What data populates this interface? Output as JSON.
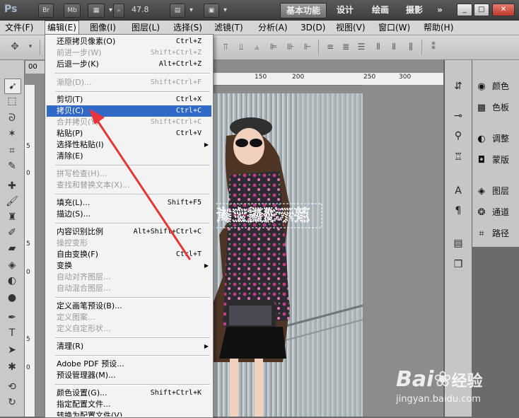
{
  "appbar": {
    "logo": "Ps",
    "btn_br": "Br",
    "btn_mb": "Mb",
    "zoom": "47.8",
    "workspaces": [
      "基本功能",
      "设计",
      "绘画",
      "摄影"
    ],
    "more": "»",
    "window_controls": [
      "_",
      "□",
      "✕"
    ]
  },
  "menubar": {
    "items": [
      "文件(F)",
      "编辑(E)",
      "图像(I)",
      "图层(L)",
      "选择(S)",
      "滤镜(T)",
      "分析(A)",
      "3D(D)",
      "视图(V)",
      "窗口(W)",
      "帮助(H)"
    ],
    "open_index": 1
  },
  "document": {
    "tab_label": "00",
    "ruler_ticks": [
      "150",
      "200",
      "250",
      "300"
    ],
    "ruler_left_ticks": [
      "5",
      "0",
      "5",
      "0",
      "5",
      "0"
    ],
    "selection_text": "淘宝摄影示范"
  },
  "edit_menu": {
    "items": [
      {
        "label": "还原拷贝像素(O)",
        "shortcut": "Ctrl+Z",
        "disabled": false
      },
      {
        "label": "前进一步(W)",
        "shortcut": "Shift+Ctrl+Z",
        "disabled": true
      },
      {
        "label": "后退一步(K)",
        "shortcut": "Alt+Ctrl+Z",
        "disabled": false
      },
      {
        "label": "渐隐(D)...",
        "shortcut": "Shift+Ctrl+F",
        "disabled": true
      },
      {
        "label": "剪切(T)",
        "shortcut": "Ctrl+X",
        "disabled": false
      },
      {
        "label": "拷贝(C)",
        "shortcut": "Ctrl+C",
        "disabled": false,
        "highlighted": true
      },
      {
        "label": "合并拷贝(Y)",
        "shortcut": "Shift+Ctrl+C",
        "disabled": true
      },
      {
        "label": "粘贴(P)",
        "shortcut": "Ctrl+V",
        "disabled": false
      },
      {
        "label": "选择性粘贴(I)",
        "shortcut": "",
        "disabled": false,
        "submenu": true
      },
      {
        "label": "清除(E)",
        "shortcut": "",
        "disabled": false
      },
      {
        "label": "拼写检查(H)...",
        "shortcut": "",
        "disabled": true
      },
      {
        "label": "查找和替换文本(X)...",
        "shortcut": "",
        "disabled": true
      },
      {
        "label": "填充(L)...",
        "shortcut": "Shift+F5",
        "disabled": false
      },
      {
        "label": "描边(S)...",
        "shortcut": "",
        "disabled": false
      },
      {
        "label": "内容识别比例",
        "shortcut": "Alt+Shift+Ctrl+C",
        "disabled": false
      },
      {
        "label": "操控变形",
        "shortcut": "",
        "disabled": true
      },
      {
        "label": "自由变换(F)",
        "shortcut": "Ctrl+T",
        "disabled": false
      },
      {
        "label": "变换",
        "shortcut": "",
        "disabled": false,
        "submenu": true
      },
      {
        "label": "自动对齐图层...",
        "shortcut": "",
        "disabled": true
      },
      {
        "label": "自动混合图层...",
        "shortcut": "",
        "disabled": true
      },
      {
        "label": "定义画笔预设(B)...",
        "shortcut": "",
        "disabled": false
      },
      {
        "label": "定义图案...",
        "shortcut": "",
        "disabled": true
      },
      {
        "label": "定义自定形状...",
        "shortcut": "",
        "disabled": true
      },
      {
        "label": "清理(R)",
        "shortcut": "",
        "disabled": false,
        "submenu": true
      },
      {
        "label": "Adobe PDF 预设...",
        "shortcut": "",
        "disabled": false
      },
      {
        "label": "预设管理器(M)...",
        "shortcut": "",
        "disabled": false
      },
      {
        "label": "颜色设置(G)...",
        "shortcut": "Shift+Ctrl+K",
        "disabled": false
      },
      {
        "label": "指定配置文件...",
        "shortcut": "",
        "disabled": false
      },
      {
        "label": "转换为配置文件(V)...",
        "shortcut": "",
        "disabled": false
      }
    ]
  },
  "panels": {
    "right": [
      {
        "icon": "palette-icon",
        "label": "颜色"
      },
      {
        "icon": "swatches-icon",
        "label": "色板"
      },
      {
        "icon": "adjustments-icon",
        "label": "调整"
      },
      {
        "icon": "mask-icon",
        "label": "蒙版"
      },
      {
        "icon": "layers-icon",
        "label": "图层"
      },
      {
        "icon": "channels-icon",
        "label": "通道"
      },
      {
        "icon": "paths-icon",
        "label": "路径"
      }
    ]
  },
  "watermark": {
    "brand": "Bai",
    "brand_cn": "经验",
    "url": "jingyan.baidu.com"
  },
  "colors": {
    "highlight": "#3169c6",
    "arrow": "#e8343a",
    "menu_bg": "#f3f3f3"
  }
}
